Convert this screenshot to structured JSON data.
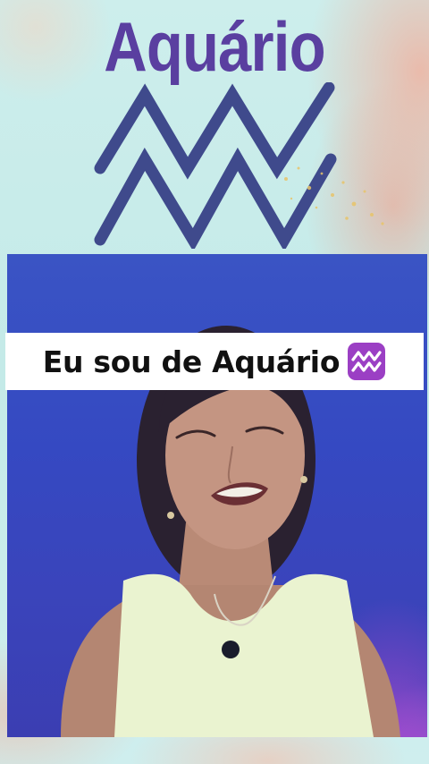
{
  "title": "Aquário",
  "caption": {
    "text": "Eu sou de Aquário",
    "emoji_icon": "aquarius-sign-icon"
  },
  "glyph_icon": "aquarius-glyph-icon",
  "colors": {
    "title": "#5a3fa0",
    "glyph_stroke": "#3f4a8c",
    "background": "#c8ecea",
    "accent_coral": "#f2a996",
    "video_blue": "#3a4bc0",
    "video_purple": "#a64bd0",
    "emoji_bg": "#9b3fc4"
  }
}
